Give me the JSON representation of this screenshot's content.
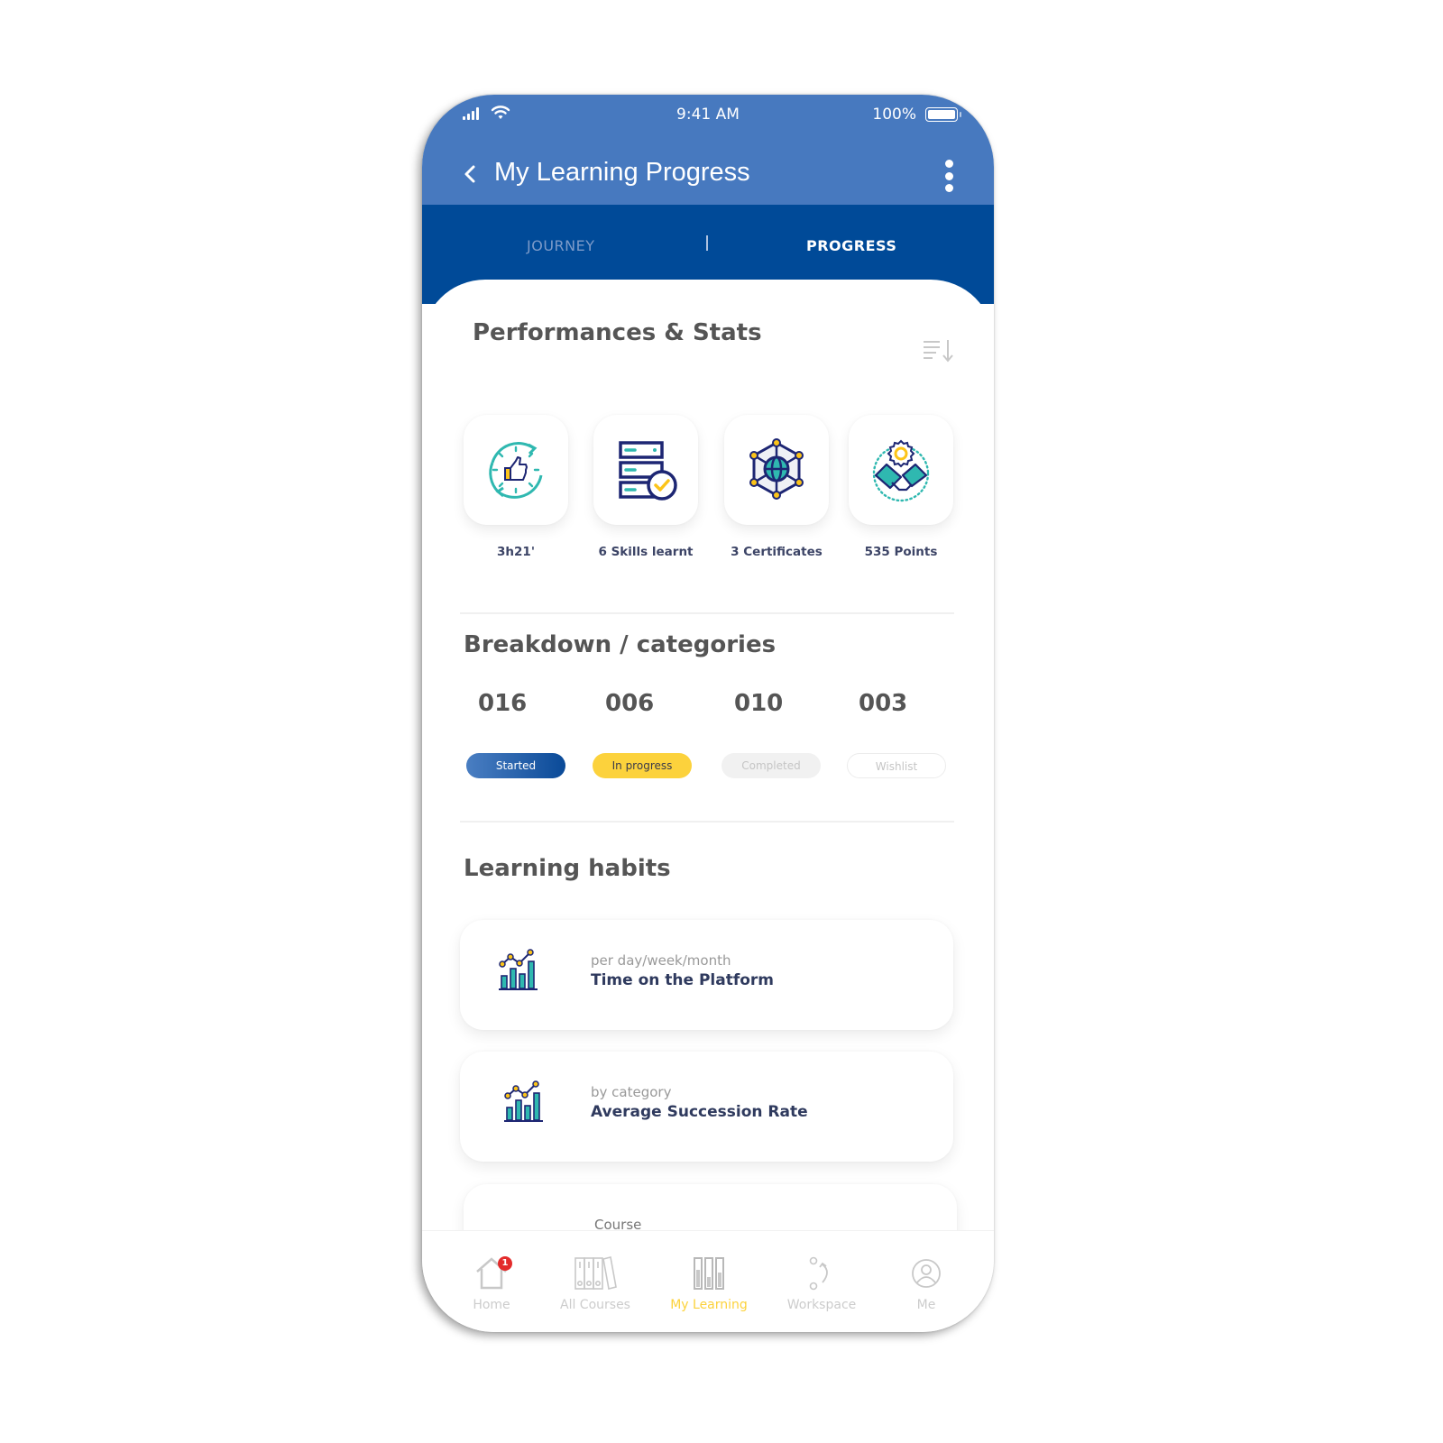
{
  "status_bar": {
    "time": "9:41 AM",
    "battery_pct": "100%",
    "icons": [
      "signal-icon",
      "wifi-icon",
      "battery-icon"
    ]
  },
  "header": {
    "title": "My Learning Progress",
    "back_icon": "chevron-left-icon",
    "menu_icon": "kebab-menu-icon"
  },
  "tabs": [
    {
      "label": "JOURNEY",
      "active": false
    },
    {
      "label": "PROGRESS",
      "active": true
    }
  ],
  "performance": {
    "title": "Performances & Stats",
    "sort_icon": "sort-descending-icon",
    "stats": [
      {
        "label": "3h21'",
        "icon": "clock-thumbs-up-icon"
      },
      {
        "label": "6 Skills learnt",
        "icon": "stacked-skills-check-icon"
      },
      {
        "label": "3 Certificates",
        "icon": "network-globe-icon"
      },
      {
        "label": "535 Points",
        "icon": "handshake-badge-icon"
      }
    ]
  },
  "breakdown": {
    "title": "Breakdown / categories",
    "items": [
      {
        "count": "016",
        "label": "Started"
      },
      {
        "count": "006",
        "label": "In progress"
      },
      {
        "count": "010",
        "label": "Completed"
      },
      {
        "count": "003",
        "label": "Wishlist"
      }
    ],
    "colors": {
      "started": "#0a4a98",
      "in_progress": "#fcd23c",
      "completed": "#f1f1f1",
      "wishlist": "#ffffff"
    }
  },
  "habits": {
    "title": "Learning habits",
    "items": [
      {
        "subtitle": "per day/week/month",
        "title": "Time on the Platform",
        "icon": "bar-line-chart-icon"
      },
      {
        "subtitle": "by category",
        "title": "Average Succession Rate",
        "icon": "bar-line-chart-icon"
      },
      {
        "subtitle": "Course",
        "title": ""
      }
    ]
  },
  "bottom_nav": {
    "items": [
      {
        "label": "Home",
        "icon": "home-icon",
        "badge": "1",
        "active": false
      },
      {
        "label": "All Courses",
        "icon": "books-icon",
        "active": false
      },
      {
        "label": "My Learning",
        "icon": "progress-bars-icon",
        "active": true
      },
      {
        "label": "Workspace",
        "icon": "workflow-icon",
        "active": false
      },
      {
        "label": "Me",
        "icon": "user-icon",
        "active": false
      }
    ]
  },
  "colors": {
    "appbar": "#4779bf",
    "tabbar": "#004a98",
    "accent": "#fcd23c",
    "teal": "#2fb8b0",
    "navy": "#1d2673"
  }
}
